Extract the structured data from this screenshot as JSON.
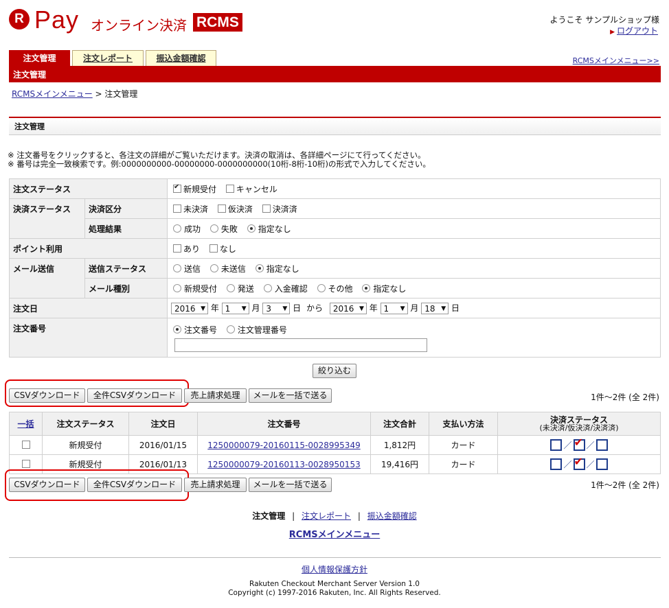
{
  "header": {
    "logo_r": "R",
    "logo_pay": "Pay",
    "logo_sub": "オンライン決済",
    "logo_rcms": "RCMS",
    "welcome": "ようこそ サンプルショップ様",
    "logout": "ログアウト"
  },
  "tabs": [
    {
      "label": "注文管理"
    },
    {
      "label": "注文レポート"
    },
    {
      "label": "振込金額確認"
    }
  ],
  "rcms_main_link": "RCMSメインメニュー>>",
  "page_title": "注文管理",
  "breadcrumb": {
    "home": "RCMSメインメニュー",
    "sep": " > ",
    "current": "注文管理"
  },
  "section_title": "注文管理",
  "notes": [
    "※ 注文番号をクリックすると、各注文の詳細がご覧いただけます。決済の取消は、各詳細ページにて行ってください。",
    "※ 番号は完全一致検索です。例:0000000000-00000000-0000000000(10桁-8桁-10桁)の形式で入力してください。"
  ],
  "filter": {
    "order_status": {
      "label": "注文ステータス",
      "opts": [
        "新規受付",
        "キャンセル"
      ]
    },
    "payment_status": {
      "label": "決済ステータス"
    },
    "payment_type": {
      "label": "決済区分",
      "opts": [
        "未決済",
        "仮決済",
        "決済済"
      ]
    },
    "process_result": {
      "label": "処理結果",
      "opts": [
        "成功",
        "失敗",
        "指定なし"
      ]
    },
    "point": {
      "label": "ポイント利用",
      "opts": [
        "あり",
        "なし"
      ]
    },
    "mail": {
      "label": "メール送信"
    },
    "send_status": {
      "label": "送信ステータス",
      "opts": [
        "送信",
        "未送信",
        "指定なし"
      ]
    },
    "mail_type": {
      "label": "メール種別",
      "opts": [
        "新規受付",
        "発送",
        "入金確認",
        "その他",
        "指定なし"
      ]
    },
    "order_date": {
      "label": "注文日",
      "from_year": "2016",
      "from_month": "1",
      "from_day": "3",
      "to_year": "2016",
      "to_month": "1",
      "to_day": "18",
      "year": "年",
      "month": "月",
      "day": "日",
      "from": "から"
    },
    "order_number": {
      "label": "注文番号",
      "opts": [
        "注文番号",
        "注文管理番号"
      ],
      "value": ""
    },
    "submit": "絞り込む"
  },
  "actions": {
    "csv": "CSVダウンロード",
    "csv_all": "全件CSVダウンロード",
    "sales": "売上請求処理",
    "mail": "メールを一括で送る",
    "count": "1件～2件 (全 2件)"
  },
  "results": {
    "headers": [
      "一括",
      "注文ステータス",
      "注文日",
      "注文番号",
      "注文合計",
      "支払い方法",
      "決済ステータス"
    ],
    "status_sub": "(未決済/仮決済/決済済)",
    "rows": [
      {
        "status": "新規受付",
        "date": "2016/01/15",
        "number": "1250000079-20160115-0028995349",
        "total": "1,812円",
        "method": "カード"
      },
      {
        "status": "新規受付",
        "date": "2016/01/13",
        "number": "1250000079-20160113-0028950153",
        "total": "19,416円",
        "method": "カード"
      }
    ]
  },
  "footer": {
    "nav_current": "注文管理",
    "nav_sep": "|",
    "nav_report": "注文レポート",
    "nav_transfer": "振込金額確認",
    "rcms_main": "RCMSメインメニュー",
    "privacy": "個人情報保護方針",
    "version": "Rakuten Checkout Merchant Server Version 1.0",
    "copyright": "Copyright (c) 1997-2016 Rakuten, Inc. All Rights Reserved."
  },
  "colors": {
    "brand_red": "#bf0000",
    "highlight_red": "#e00000",
    "checkbox_blue": "#1e3c8c"
  }
}
